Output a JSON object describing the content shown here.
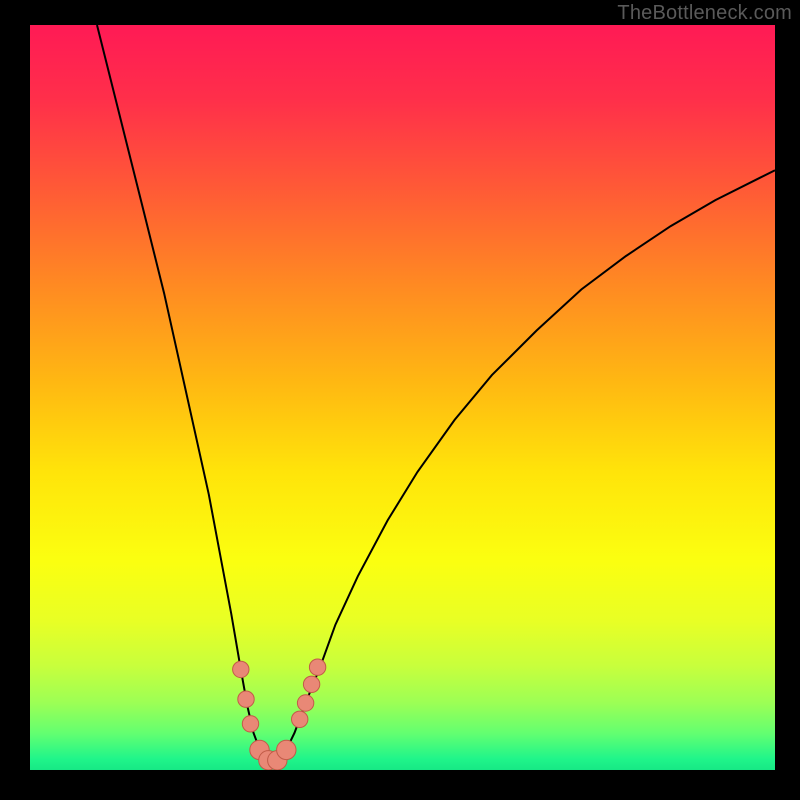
{
  "watermark": "TheBottleneck.com",
  "colors": {
    "gradient_stops": [
      {
        "offset": 0.0,
        "color": "#ff1a55"
      },
      {
        "offset": 0.1,
        "color": "#ff2f4a"
      },
      {
        "offset": 0.22,
        "color": "#ff5a36"
      },
      {
        "offset": 0.35,
        "color": "#ff8a22"
      },
      {
        "offset": 0.48,
        "color": "#ffb812"
      },
      {
        "offset": 0.6,
        "color": "#ffe40a"
      },
      {
        "offset": 0.72,
        "color": "#fbff10"
      },
      {
        "offset": 0.8,
        "color": "#e8ff25"
      },
      {
        "offset": 0.86,
        "color": "#c8ff3c"
      },
      {
        "offset": 0.91,
        "color": "#9cff55"
      },
      {
        "offset": 0.95,
        "color": "#64ff70"
      },
      {
        "offset": 0.985,
        "color": "#20f58a"
      },
      {
        "offset": 1.0,
        "color": "#17e885"
      }
    ],
    "curve": "#000000",
    "marker_fill": "#e98876",
    "marker_stroke": "#c25b48"
  },
  "chart_data": {
    "type": "line",
    "title": "",
    "xlabel": "",
    "ylabel": "",
    "xlim": [
      0,
      100
    ],
    "ylim": [
      0,
      100
    ],
    "series": [
      {
        "name": "bottleneck-curve",
        "x": [
          9,
          12,
          15,
          18,
          20,
          22,
          24,
          25.5,
          27,
          28.3,
          29.2,
          30,
          31,
          32,
          33,
          34.2,
          35.5,
          37,
          39,
          41,
          44,
          48,
          52,
          57,
          62,
          68,
          74,
          80,
          86,
          92,
          98,
          100
        ],
        "y": [
          100,
          88,
          76,
          64,
          55,
          46,
          37,
          29,
          21,
          13.5,
          8.5,
          5,
          2.3,
          1.2,
          1.2,
          2.3,
          5,
          9,
          14,
          19.5,
          26,
          33.5,
          40,
          47,
          53,
          59,
          64.5,
          69,
          73,
          76.5,
          79.5,
          80.5
        ]
      }
    ],
    "markers": [
      {
        "x": 28.3,
        "y": 13.5,
        "r": 1.1
      },
      {
        "x": 29.0,
        "y": 9.5,
        "r": 1.1
      },
      {
        "x": 29.6,
        "y": 6.2,
        "r": 1.1
      },
      {
        "x": 30.8,
        "y": 2.7,
        "r": 1.3
      },
      {
        "x": 32.0,
        "y": 1.3,
        "r": 1.3
      },
      {
        "x": 33.2,
        "y": 1.3,
        "r": 1.3
      },
      {
        "x": 34.4,
        "y": 2.7,
        "r": 1.3
      },
      {
        "x": 36.2,
        "y": 6.8,
        "r": 1.1
      },
      {
        "x": 37.0,
        "y": 9.0,
        "r": 1.1
      },
      {
        "x": 37.8,
        "y": 11.5,
        "r": 1.1
      },
      {
        "x": 38.6,
        "y": 13.8,
        "r": 1.1
      }
    ]
  }
}
